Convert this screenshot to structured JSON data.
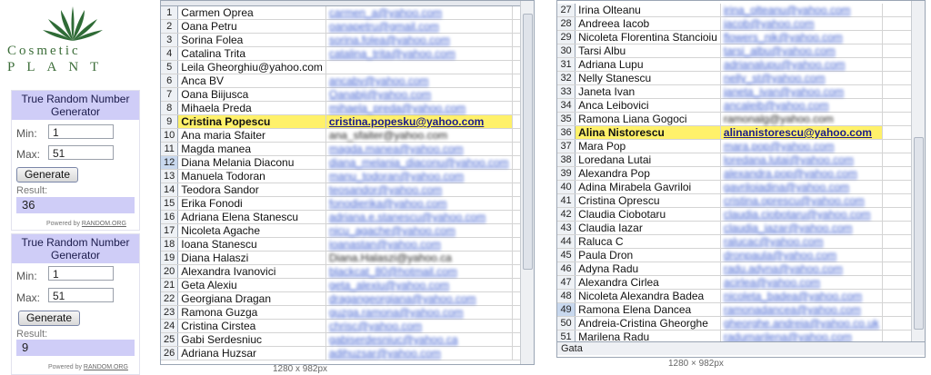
{
  "brand": {
    "line1": "Cosmetic",
    "line2": "PLANT"
  },
  "rng": [
    {
      "title": "True Random Number Generator",
      "min_label": "Min:",
      "min_value": "1",
      "max_label": "Max:",
      "max_value": "51",
      "button": "Generate",
      "result_label": "Result:",
      "result": "36",
      "powered_by": "Powered by",
      "powered_site": "RANDOM.ORG"
    },
    {
      "title": "True Random Number Generator",
      "min_label": "Min:",
      "min_value": "1",
      "max_label": "Max:",
      "max_value": "51",
      "button": "Generate",
      "result_label": "Result:",
      "result": "9",
      "powered_by": "Powered by",
      "powered_site": "RANDOM.ORG"
    }
  ],
  "sheet_left": {
    "rows": [
      {
        "n": "1",
        "name": "Carmen Oprea",
        "email": "carmen_a@yahoo.com"
      },
      {
        "n": "2",
        "name": "Oana Petru",
        "email": "oanapetru@gmail.com"
      },
      {
        "n": "3",
        "name": "Sorina Folea",
        "email": "sorina.folea@yahoo.com"
      },
      {
        "n": "4",
        "name": "Catalina Trita",
        "email": "catalina_trita@yahoo.com"
      },
      {
        "n": "5",
        "name": "Leila Gheorghiu@yahoo.com",
        "email": ""
      },
      {
        "n": "6",
        "name": "Anca BV",
        "email": "ancabv@yahoo.com"
      },
      {
        "n": "7",
        "name": "Oana Biijusca",
        "email": "Oanabij@yahoo.com"
      },
      {
        "n": "8",
        "name": "Mihaela Preda",
        "email": "mihaela_preda@yahoo.com"
      },
      {
        "n": "9",
        "name": "Cristina Popescu",
        "email": "cristina.popesku@yahoo.com",
        "hl": true
      },
      {
        "n": "10",
        "name": "Ana maria Sfaiter",
        "email": "ana_sfaiter@yahoo.com",
        "plain": true
      },
      {
        "n": "11",
        "name": "Magda manea",
        "email": "magda.manea@yahoo.com"
      },
      {
        "n": "12",
        "name": "Diana Melania Diaconu",
        "email": "diana_melania_diaconu@yahoo.com",
        "sel": true
      },
      {
        "n": "13",
        "name": "Manuela Todoran",
        "email": "manu_todoran@yahoo.com"
      },
      {
        "n": "14",
        "name": "Teodora Sandor",
        "email": "teosandor@yahoo.com"
      },
      {
        "n": "15",
        "name": "Erika Fonodi",
        "email": "fonodierika@yahoo.com"
      },
      {
        "n": "16",
        "name": "Adriana Elena Stanescu",
        "email": "adriana.e.stanescu@yahoo.com"
      },
      {
        "n": "17",
        "name": "Nicoleta Agache",
        "email": "nicu_agache@yahoo.com"
      },
      {
        "n": "18",
        "name": "Ioana Stanescu",
        "email": "ioanastan@yahoo.com"
      },
      {
        "n": "19",
        "name": "Diana Halaszi",
        "email": "Diana.Halaszi@yahoo.ca",
        "plain": true
      },
      {
        "n": "20",
        "name": "Alexandra Ivanovici",
        "email": "blackcat_80@hotmail.com"
      },
      {
        "n": "21",
        "name": "Geta Alexiu",
        "email": "geta_alexiu@yahoo.com"
      },
      {
        "n": "22",
        "name": "Georgiana Dragan",
        "email": "dragangeorgiana@yahoo.com"
      },
      {
        "n": "23",
        "name": "Ramona Guzga",
        "email": "guzga.ramona@yahoo.com"
      },
      {
        "n": "24",
        "name": "Cristina Cirstea",
        "email": "chrisc@yahoo.com"
      },
      {
        "n": "25",
        "name": "Gabi Serdesniuc",
        "email": "gabiserdesniuc@yahoo.ca"
      },
      {
        "n": "26",
        "name": "Adriana Huzsar",
        "email": "adihuzsar@yahoo.com"
      }
    ]
  },
  "sheet_right": {
    "rows": [
      {
        "n": "27",
        "name": "Irina Olteanu",
        "email": "irina_olteanu@yahoo.com"
      },
      {
        "n": "28",
        "name": "Andreea Iacob",
        "email": "jacob@yahoo.com"
      },
      {
        "n": "29",
        "name": "Nicoleta Florentina Stancioiu",
        "email": "flowers_nik@yahoo.com"
      },
      {
        "n": "30",
        "name": "Tarsi Albu",
        "email": "tarsi_albu@yahoo.com"
      },
      {
        "n": "31",
        "name": "Adriana Lupu",
        "email": "adrianalupu@yahoo.com"
      },
      {
        "n": "32",
        "name": "Nelly Stanescu",
        "email": "nelly_st@yahoo.com"
      },
      {
        "n": "33",
        "name": "Janeta Ivan",
        "email": "janeta_ivan@yahoo.com"
      },
      {
        "n": "34",
        "name": "Anca Leibovici",
        "email": "ancaleib@yahoo.com"
      },
      {
        "n": "35",
        "name": "Ramona Liana Gogoci",
        "email": "ramonalg@yahoo.com",
        "plain": true
      },
      {
        "n": "36",
        "name": "Alina Nistorescu",
        "email": "alinanistorescu@yahoo.com",
        "hl": true
      },
      {
        "n": "37",
        "name": "Mara Pop",
        "email": "mara.pop@yahoo.com"
      },
      {
        "n": "38",
        "name": "Loredana Lutai",
        "email": "loredana.lutai@yahoo.com"
      },
      {
        "n": "39",
        "name": "Alexandra Pop",
        "email": "alexandra.pop@yahoo.com"
      },
      {
        "n": "40",
        "name": "Adina Mirabela Gavriloi",
        "email": "gavriloiadina@yahoo.com"
      },
      {
        "n": "41",
        "name": "Cristina Oprescu",
        "email": "cristina.oprescu@yahoo.com"
      },
      {
        "n": "42",
        "name": "Claudia Ciobotaru",
        "email": "claudia.ciobotaru@yahoo.com"
      },
      {
        "n": "43",
        "name": "Claudia Iazar",
        "email": "claudia_iazar@yahoo.com"
      },
      {
        "n": "44",
        "name": "Raluca C",
        "email": "ralucac@yahoo.com"
      },
      {
        "n": "45",
        "name": "Paula Dron",
        "email": "dronpaula@yahoo.com"
      },
      {
        "n": "46",
        "name": "Adyna Radu",
        "email": "radu.adyna@yahoo.com"
      },
      {
        "n": "47",
        "name": "Alexandra Cirlea",
        "email": "acirlea@yahoo.com"
      },
      {
        "n": "48",
        "name": "Nicoleta Alexandra Badea",
        "email": "nicoleta_badea@yahoo.com"
      },
      {
        "n": "49",
        "name": "Ramona Elena Dancea",
        "email": "ramonadancea@yahoo.com",
        "sel": true
      },
      {
        "n": "50",
        "name": "Andreia-Cristina Gheorghe",
        "email": "gheorghe.andreia@yahoo.co.uk"
      },
      {
        "n": "51",
        "name": "Marilena Radu",
        "email": "radumarilena@yahoo.com"
      }
    ],
    "sheet_tab": "Gata"
  },
  "captions": {
    "left": "1280 x 982px",
    "right": "1280 × 982px"
  },
  "colors": {
    "highlight": "#fff16a",
    "rng_panel": "#cfcdf7",
    "brand_green": "#3d6e3a",
    "link_blue": "#3b5ccf"
  }
}
